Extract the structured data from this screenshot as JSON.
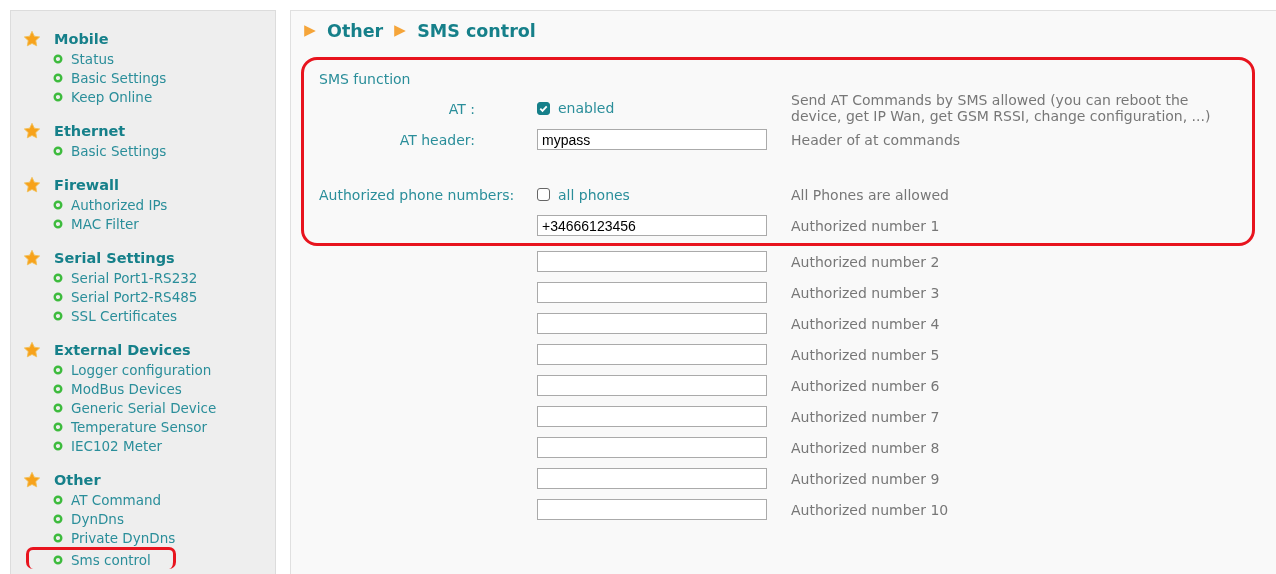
{
  "sidebar": {
    "groups": [
      {
        "title": "Mobile",
        "items": [
          {
            "label": "Status",
            "circled": false
          },
          {
            "label": "Basic Settings",
            "circled": false
          },
          {
            "label": "Keep Online",
            "circled": false
          }
        ]
      },
      {
        "title": "Ethernet",
        "items": [
          {
            "label": "Basic Settings",
            "circled": false
          }
        ]
      },
      {
        "title": "Firewall",
        "items": [
          {
            "label": "Authorized IPs",
            "circled": false
          },
          {
            "label": "MAC Filter",
            "circled": false
          }
        ]
      },
      {
        "title": "Serial Settings",
        "items": [
          {
            "label": "Serial Port1-RS232",
            "circled": false
          },
          {
            "label": "Serial Port2-RS485",
            "circled": false
          },
          {
            "label": "SSL Certificates",
            "circled": false
          }
        ]
      },
      {
        "title": "External Devices",
        "items": [
          {
            "label": "Logger configuration",
            "circled": false
          },
          {
            "label": "ModBus Devices",
            "circled": false
          },
          {
            "label": "Generic Serial Device",
            "circled": false
          },
          {
            "label": "Temperature Sensor",
            "circled": false
          },
          {
            "label": "IEC102 Meter",
            "circled": false
          }
        ]
      },
      {
        "title": "Other",
        "items": [
          {
            "label": "AT Command",
            "circled": false
          },
          {
            "label": "DynDns",
            "circled": false
          },
          {
            "label": "Private DynDns",
            "circled": false
          },
          {
            "label": "Sms control",
            "circled": true
          }
        ]
      }
    ]
  },
  "breadcrumb": [
    "Other",
    "SMS control"
  ],
  "form": {
    "rows": [
      {
        "kind": "heading",
        "circled": true,
        "label": "SMS function"
      },
      {
        "kind": "checkbox",
        "circled": true,
        "label": "AT :",
        "checked": true,
        "option": "enabled",
        "description": "Send AT Commands by SMS allowed (you can reboot the device, get IP Wan, get GSM RSSI, change configuration, ...)"
      },
      {
        "kind": "text",
        "circled": true,
        "label": "AT header:",
        "value": "mypass",
        "description": "Header of at commands"
      },
      {
        "kind": "checkbox",
        "circled": true,
        "label": "Authorized phone numbers:",
        "checked": false,
        "option": "all phones",
        "description": "All Phones are allowed"
      },
      {
        "kind": "text",
        "circled": true,
        "value": "+34666123456",
        "description": "Authorized number 1"
      },
      {
        "kind": "text",
        "circled": false,
        "value": "",
        "description": "Authorized number 2"
      },
      {
        "kind": "text",
        "circled": false,
        "value": "",
        "description": "Authorized number 3"
      },
      {
        "kind": "text",
        "circled": false,
        "value": "",
        "description": "Authorized number 4"
      },
      {
        "kind": "text",
        "circled": false,
        "value": "",
        "description": "Authorized number 5"
      },
      {
        "kind": "text",
        "circled": false,
        "value": "",
        "description": "Authorized number 6"
      },
      {
        "kind": "text",
        "circled": false,
        "value": "",
        "description": "Authorized number 7"
      },
      {
        "kind": "text",
        "circled": false,
        "value": "",
        "description": "Authorized number 8"
      },
      {
        "kind": "text",
        "circled": false,
        "value": "",
        "description": "Authorized number 9"
      },
      {
        "kind": "text",
        "circled": false,
        "value": "",
        "description": "Authorized number 10"
      }
    ]
  }
}
